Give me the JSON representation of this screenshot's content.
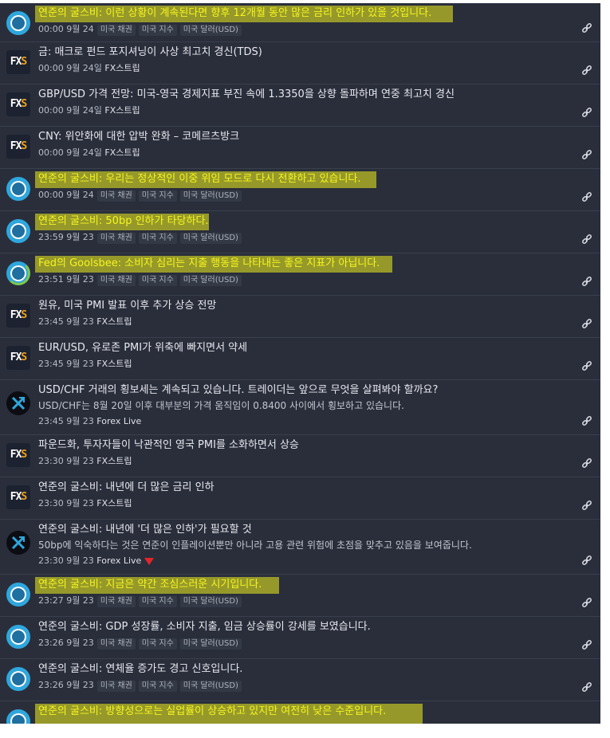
{
  "colors": {
    "panel": "#2a2e3b",
    "highlight": "#eef21d",
    "headline_highlight": "#f5f51e",
    "circle_icon": "#2ea7dd",
    "alert": "#e3262a"
  },
  "icons": {
    "circle": "blue-ring-icon",
    "fxs": "fxstreet-logo-icon",
    "forexlive": "forexlive-logo-icon",
    "link": "link-icon"
  },
  "items": [
    {
      "icon": "circle",
      "title": "연준의 굴스비: 이런 상황이 계속된다면 향후 12개월 동안 많은 금리 인하가 있을 것입니다.",
      "time": "00:00 9월 24",
      "tags": [
        "미국 채권",
        "미국 지수",
        "미국 달러(USD)"
      ],
      "source": "",
      "highlight": true
    },
    {
      "icon": "fxs",
      "title": "금: 매크로 펀드 포지셔닝이 사상 최고치 경신(TDS)",
      "time": "00:00 9월 24일",
      "tags": [],
      "source": "FX스트립",
      "highlight": false
    },
    {
      "icon": "fxs",
      "title": "GBP/USD 가격 전망: 미국-영국 경제지표 부진 속에 1.3350을 상향 돌파하며 연중 최고치 경신",
      "time": "00:00 9월 24일",
      "tags": [],
      "source": "FX스트립",
      "highlight": false
    },
    {
      "icon": "fxs",
      "title": "CNY: 위안화에 대한 압박 완화 – 코메르츠방크",
      "time": "00:00 9월 24일",
      "tags": [],
      "source": "FX스트립",
      "highlight": false
    },
    {
      "icon": "circle",
      "title": "연준의 굴스비: 우리는 정상적인 이중 위임 모드로 다시 전환하고 있습니다.",
      "time": "00:00 9월 24",
      "tags": [
        "미국 채권",
        "미국 지수",
        "미국 달러(USD)"
      ],
      "source": "",
      "highlight": true
    },
    {
      "icon": "circle",
      "title": "연준의 굴스비: 50bp 인하가 타당하다.",
      "time": "23:59 9월 23",
      "tags": [
        "미국 채권",
        "미국 지수",
        "미국 달러(USD)"
      ],
      "source": "",
      "highlight": true
    },
    {
      "icon": "circle",
      "title": "Fed의 Goolsbee: 소비자 심리는 지출 행동을 나타내는 좋은 지표가 아닙니다.",
      "time": "23:51 9월 23",
      "tags": [
        "미국 채권",
        "미국 지수",
        "미국 달러(USD)"
      ],
      "source": "",
      "highlight": true
    },
    {
      "icon": "fxs",
      "title": "원유, 미국 PMI 발표 이후 추가 상승 전망",
      "time": "23:45 9월 23",
      "tags": [],
      "source": "FX스트립",
      "highlight": false
    },
    {
      "icon": "fxs",
      "title": "EUR/USD, 유로존 PMI가 위축에 빠지면서 약세",
      "time": "23:45 9월 23",
      "tags": [],
      "source": "FX스트립",
      "highlight": false
    },
    {
      "icon": "forexlive",
      "title": "USD/CHF 거래의 횡보세는 계속되고 있습니다. 트레이더는 앞으로 무엇을 살펴봐야 할까요?",
      "desc": "USD/CHF는 8월 20일 이후 대부분의 가격 움직임이 0.8400 사이에서 횡보하고 있습니다.",
      "time": "23:45 9월 23",
      "tags": [],
      "source": "Forex Live",
      "highlight": false
    },
    {
      "icon": "fxs",
      "title": "파운드화, 투자자들이 낙관적인 영국 PMI를 소화하면서 상승",
      "time": "23:30 9월 23",
      "tags": [],
      "source": "FX스트립",
      "highlight": false
    },
    {
      "icon": "fxs",
      "title": "연준의 굴스비: 내년에 더 많은 금리 인하",
      "time": "23:30 9월 23",
      "tags": [],
      "source": "FX스트립",
      "highlight": false
    },
    {
      "icon": "forexlive",
      "title": "연준의 굴스비: 내년에 '더 많은 인하'가 필요할 것",
      "desc": "50bp에 익숙하다는 것은 연준이 인플레이션뿐만 아니라 고용 관련 위험에 초점을 맞추고 있음을 보여줍니다.",
      "time": "23:30 9월 23",
      "tags": [],
      "source": "Forex Live",
      "highlight": false,
      "alert": true
    },
    {
      "icon": "circle",
      "title": "연준의 굴스비: 지금은 약간 조심스러운 시기입니다.",
      "time": "23:27 9월 23",
      "tags": [
        "미국 채권",
        "미국 지수",
        "미국 달러(USD)"
      ],
      "source": "",
      "highlight": true
    },
    {
      "icon": "circle",
      "title": "연준의 굴스비: GDP 성장률, 소비자 지출, 임금 상승률이 강세를 보였습니다.",
      "time": "23:26 9월 23",
      "tags": [
        "미국 채권",
        "미국 지수",
        "미국 달러(USD)"
      ],
      "source": "",
      "highlight": false
    },
    {
      "icon": "circle",
      "title": "연준의 굴스비: 연체율 증가도 경고 신호입니다.",
      "time": "23:26 9월 23",
      "tags": [
        "미국 채권",
        "미국 지수",
        "미국 달러(USD)"
      ],
      "source": "",
      "highlight": false
    },
    {
      "icon": "circle",
      "title": "연준의 굴스비: 방향성으로는 실업률이 상승하고 있지만 여전히 낮은 수준입니다.",
      "time": "",
      "tags": [],
      "source": "",
      "highlight": true
    }
  ]
}
